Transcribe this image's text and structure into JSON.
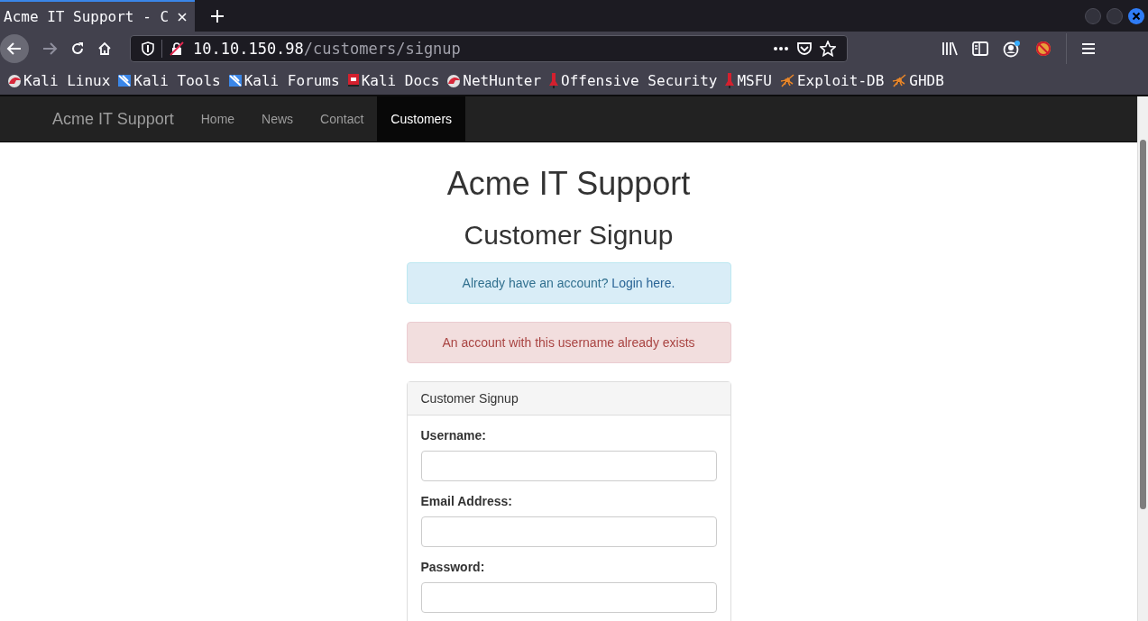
{
  "browser": {
    "tab": {
      "title": "Acme IT Support - C",
      "selected": true
    },
    "url": {
      "host": "10.10.150.98",
      "path": "/customers/signup"
    },
    "bookmarks": [
      {
        "label": "Kali Linux",
        "kind": "kali"
      },
      {
        "label": "Kali Tools",
        "kind": "tools"
      },
      {
        "label": "Kali Forums",
        "kind": "tools"
      },
      {
        "label": "Kali Docs",
        "kind": "docs"
      },
      {
        "label": "NetHunter",
        "kind": "kali"
      },
      {
        "label": "Offensive Security",
        "kind": "offsec"
      },
      {
        "label": "MSFU",
        "kind": "offsec"
      },
      {
        "label": "Exploit-DB",
        "kind": "spider"
      },
      {
        "label": "GHDB",
        "kind": "spider"
      }
    ]
  },
  "navbar": {
    "brand": "Acme IT Support",
    "items": [
      {
        "label": "Home",
        "selected": false
      },
      {
        "label": "News",
        "selected": false
      },
      {
        "label": "Contact",
        "selected": false
      },
      {
        "label": "Customers",
        "selected": true
      }
    ]
  },
  "page": {
    "title": "Acme IT Support",
    "subtitle": "Customer Signup",
    "info_alert": {
      "text": "Already have an account? ",
      "link": "Login here."
    },
    "error_alert": "An account with this username already exists",
    "panel": {
      "heading": "Customer Signup",
      "fields": [
        {
          "label": "Username:"
        },
        {
          "label": "Email Address:"
        },
        {
          "label": "Password:"
        }
      ]
    }
  }
}
